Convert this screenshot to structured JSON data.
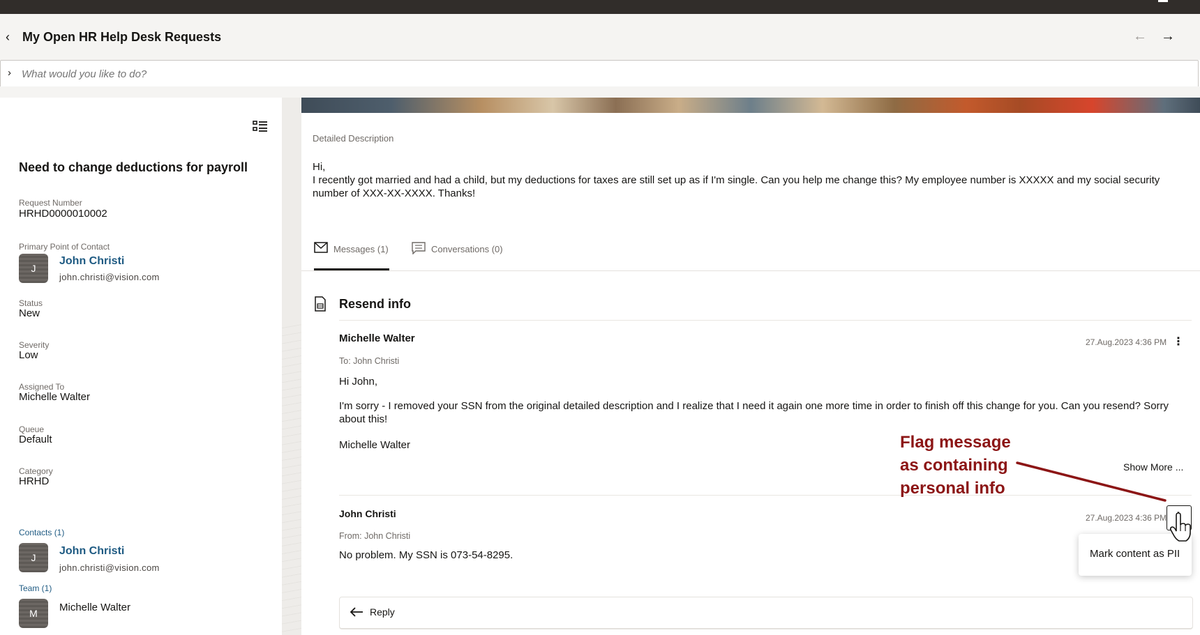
{
  "header": {
    "title": "My Open HR Help Desk Requests",
    "back_icon": "chevron-left-icon",
    "prev_icon": "arrow-left-icon",
    "next_icon": "arrow-right-icon"
  },
  "search": {
    "placeholder": "What would you like to do?"
  },
  "request": {
    "title": "Need to change deductions for payroll",
    "fields": {
      "request_number_label": "Request Number",
      "request_number": "HRHD0000010002",
      "poc_label": "Primary Point of Contact",
      "poc_initial": "J",
      "poc_name": "John Christi",
      "poc_email": "john.christi@vision.com",
      "status_label": "Status",
      "status": "New",
      "severity_label": "Severity",
      "severity": "Low",
      "assigned_label": "Assigned To",
      "assigned": "Michelle Walter",
      "queue_label": "Queue",
      "queue": "Default",
      "category_label": "Category",
      "category": "HRHD"
    },
    "contacts_label": "Contacts (1)",
    "contact_initial": "J",
    "contact_name": "John Christi",
    "contact_email": "john.christi@vision.com",
    "team_label": "Team (1)",
    "team_initial": "M",
    "team_member": "Michelle Walter"
  },
  "detail": {
    "label": "Detailed Description",
    "line1": "Hi,",
    "line2": "I recently got married and had a child, but my deductions for taxes are still set up as if I'm single. Can you help me change this? My employee number is XXXXX and my social security number of XXX-XX-XXXX. Thanks!"
  },
  "tabs": {
    "messages": "Messages (1)",
    "conversations": "Conversations (0)"
  },
  "thread": {
    "subject": "Resend info",
    "messages": [
      {
        "sender": "Michelle Walter",
        "recipient": "To: John Christi",
        "time": "27.Aug.2023 4:36 PM",
        "greeting": "Hi John,",
        "body": "I'm sorry - I removed your SSN from the original detailed description and I realize that I need it again one more time in order to finish off this change for you. Can you resend? Sorry about this!",
        "signature": "Michelle Walter",
        "show_more": "Show More ..."
      },
      {
        "sender": "John Christi",
        "recipient": "From: John Christi",
        "time": "27.Aug.2023 4:36 PM",
        "body": "No problem. My SSN is 073-54-8295."
      }
    ],
    "popup_item": "Mark content as PII",
    "reply": "Reply"
  },
  "annotation": {
    "line1": "Flag message",
    "line2": "as containing",
    "line3": "personal info",
    "color": "#8c1515"
  }
}
